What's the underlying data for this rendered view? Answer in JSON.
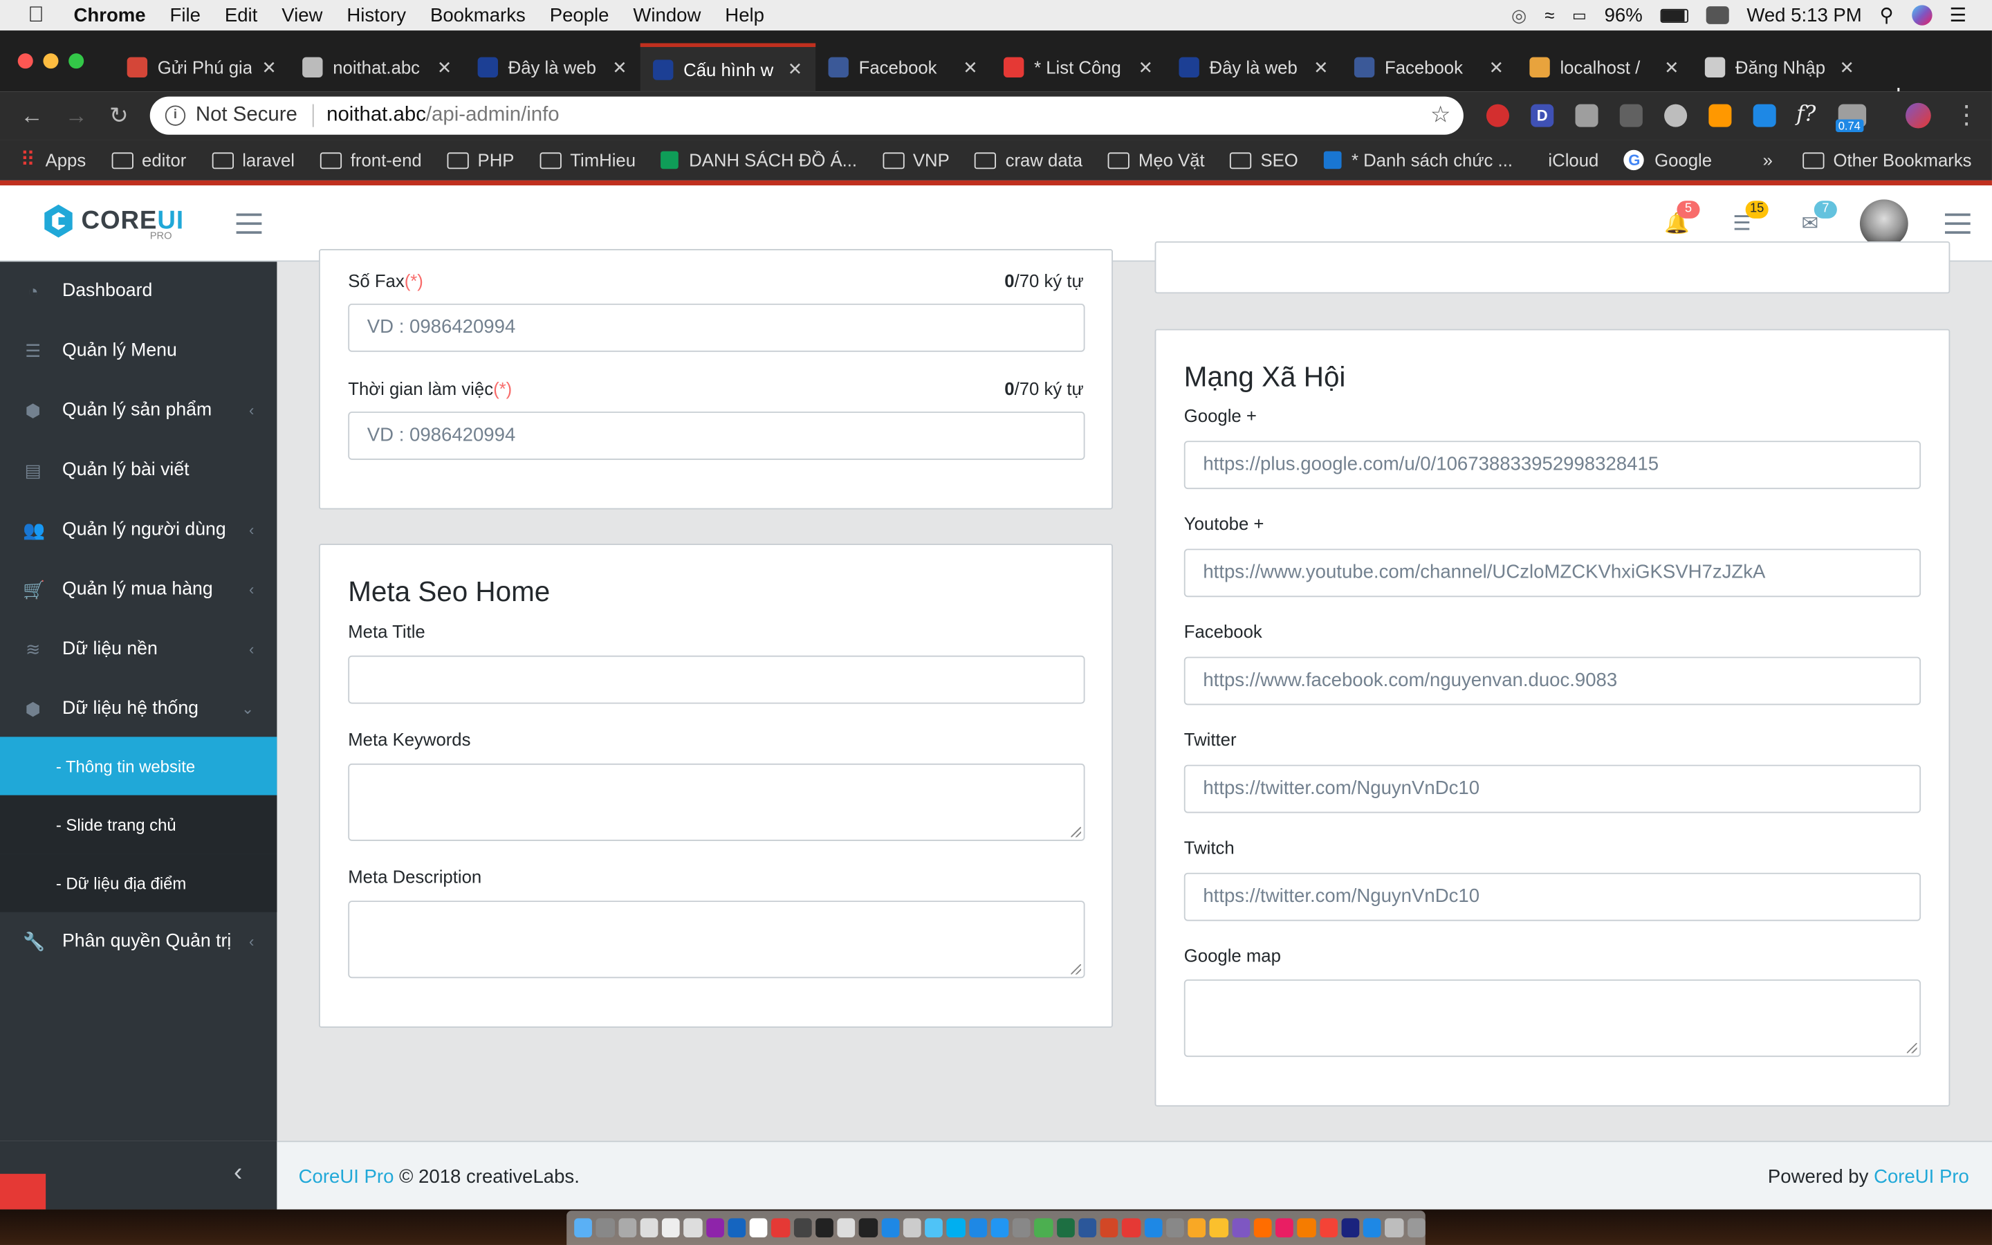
{
  "mac": {
    "app": "Chrome",
    "menus": [
      "File",
      "Edit",
      "View",
      "History",
      "Bookmarks",
      "People",
      "Window",
      "Help"
    ],
    "battery": "96%",
    "clock": "Wed 5:13 PM"
  },
  "tabs": [
    {
      "title": "Gửi Phú gia",
      "color": "#d44638"
    },
    {
      "title": "noithat.abc",
      "color": "#bbbbbb"
    },
    {
      "title": "Đây là web",
      "color": "#1c3f94"
    },
    {
      "title": "Cấu hình w",
      "color": "#1c3f94",
      "active": true
    },
    {
      "title": "Facebook",
      "color": "#3b5998"
    },
    {
      "title": "* List Công",
      "color": "#e53935"
    },
    {
      "title": "Đây là web",
      "color": "#1c3f94"
    },
    {
      "title": "Facebook",
      "color": "#3b5998"
    },
    {
      "title": "localhost /",
      "color": "#e8a33d"
    },
    {
      "title": "Đăng Nhập",
      "color": "#cccccc"
    }
  ],
  "address": {
    "security": "Not Secure",
    "host": "noithat.abc",
    "path": "/api-admin/info",
    "ext_badge": "0.74"
  },
  "bookmarks": [
    "Apps",
    "editor",
    "laravel",
    "front-end",
    "PHP",
    "TimHieu",
    "DANH SÁCH ĐỒ Á...",
    "VNP",
    "craw data",
    "Mẹo Vặt",
    "SEO",
    "* Danh sách chức ...",
    "iCloud",
    "Google",
    "»",
    "Other Bookmarks"
  ],
  "header": {
    "logo_main": "CORE",
    "logo_accent": "UI",
    "logo_sub": "PRO",
    "badges": {
      "bell": "5",
      "list": "15",
      "mail": "7"
    },
    "badge_colors": {
      "bell": "#f86c6b",
      "list": "#ffc107",
      "mail": "#63c2de"
    }
  },
  "sidebar": {
    "items": [
      {
        "label": "Dashboard",
        "icon": "speedometer-icon"
      },
      {
        "label": "Quản lý Menu",
        "icon": "list-icon"
      },
      {
        "label": "Quản lý sản phẩm",
        "icon": "cubes-icon",
        "chevron": "‹"
      },
      {
        "label": "Quản lý bài viết",
        "icon": "doc-icon"
      },
      {
        "label": "Quản lý người dùng",
        "icon": "users-icon",
        "chevron": "‹"
      },
      {
        "label": "Quản lý mua hàng",
        "icon": "cart-icon",
        "chevron": "‹"
      },
      {
        "label": "Dữ liệu nền",
        "icon": "database-icon",
        "chevron": "‹"
      },
      {
        "label": "Dữ liệu hệ thống",
        "icon": "cubes-icon",
        "chevron": "⌄"
      }
    ],
    "sub": [
      "- Thông tin website",
      "- Slide trang chủ",
      "- Dữ liệu địa điểm"
    ],
    "last": {
      "label": "Phân quyền Quản trị",
      "chevron": "‹"
    }
  },
  "left_card": {
    "fax_label": "Số Fax",
    "required": "(*)",
    "fax_count": "0",
    "fax_max": "/70 ký tự",
    "fax_placeholder": "VD : 0986420994",
    "time_label": "Thời gian làm việc",
    "time_count": "0",
    "time_max": "/70 ký tự",
    "time_placeholder": "VD : 0986420994"
  },
  "meta": {
    "title": "Meta Seo Home",
    "meta_title": "Meta Title",
    "meta_keywords": "Meta Keywords",
    "meta_description": "Meta Description"
  },
  "social": {
    "title": "Mạng Xã Hội",
    "fields": [
      {
        "label": "Google +",
        "value": "https://plus.google.com/u/0/106738833952998328415"
      },
      {
        "label": "Youtobe +",
        "value": "https://www.youtube.com/channel/UCzloMZCKVhxiGKSVH7zJZkA"
      },
      {
        "label": "Facebook",
        "value": "https://www.facebook.com/nguyenvan.duoc.9083"
      },
      {
        "label": "Twitter",
        "value": "https://twitter.com/NguynVnDc10"
      },
      {
        "label": "Twitch",
        "value": "https://twitter.com/NguynVnDc10"
      }
    ],
    "map_label": "Google map"
  },
  "footer": {
    "brand": "CoreUI Pro",
    "copy": "© 2018 creativeLabs.",
    "powered": "Powered by",
    "powered_brand": "CoreUI Pro"
  }
}
